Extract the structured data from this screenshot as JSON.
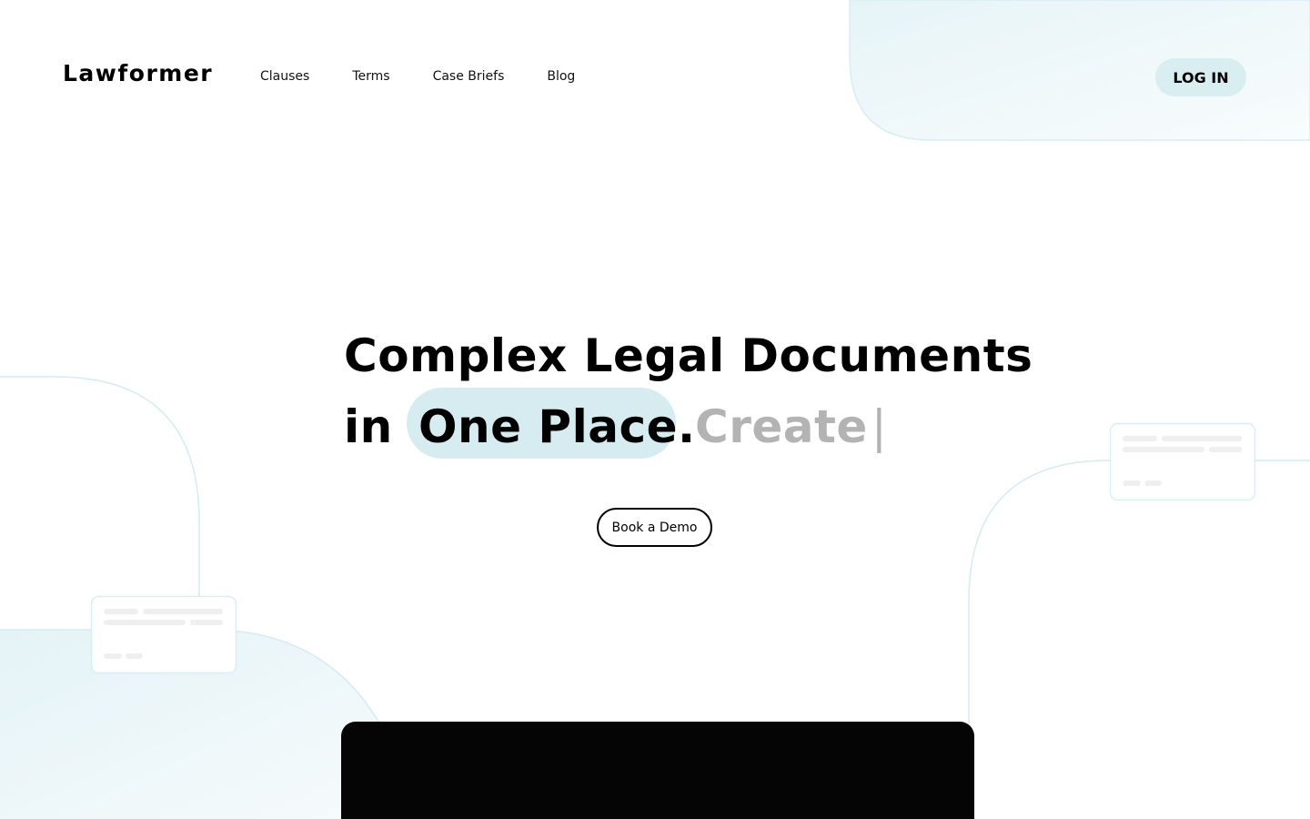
{
  "brand": {
    "name": "Lawformer"
  },
  "nav": {
    "links": [
      "Clauses",
      "Terms",
      "Case Briefs",
      "Blog"
    ],
    "login_label": "LOG IN"
  },
  "hero": {
    "line1": "Complex Legal Documents",
    "line2_prefix": "in",
    "highlight": "One Place.",
    "typed_word": "Create",
    "caret": "|"
  },
  "cta": {
    "demo_label": "Book a Demo"
  },
  "colors": {
    "accent": "#d6ecf0",
    "typed_text": "#b3b3b3",
    "outline": "#cfe8ee"
  }
}
